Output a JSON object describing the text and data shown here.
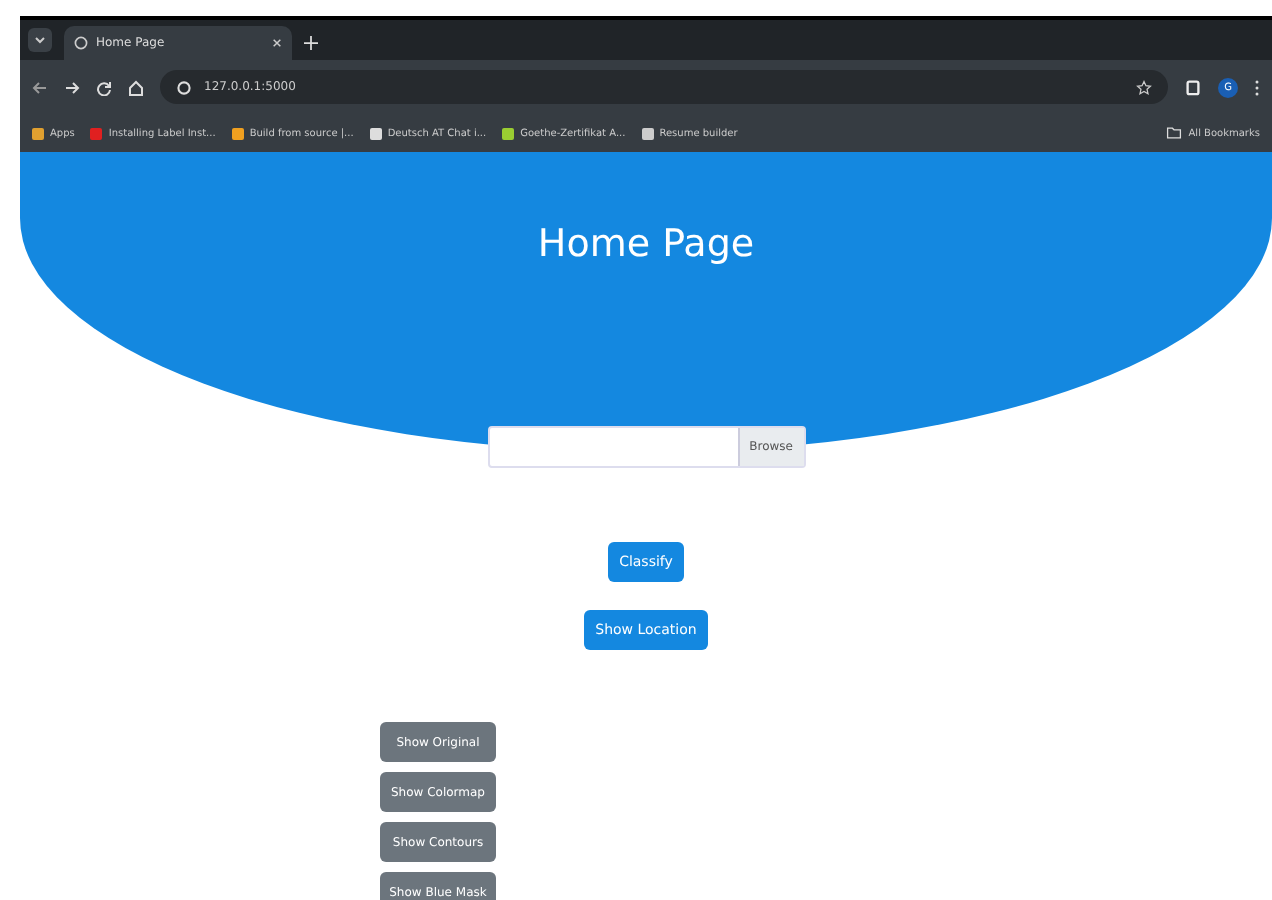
{
  "browser": {
    "tab_title": "Home Page",
    "url": "127.0.0.1:5000",
    "bookmarks": [
      {
        "label": "Apps",
        "color": "#e0a030"
      },
      {
        "label": "Installing Label Inst...",
        "color": "#e02020"
      },
      {
        "label": "Build from source |...",
        "color": "#f0a020"
      },
      {
        "label": "Deutsch AT Chat i...",
        "color": "#dddddd"
      },
      {
        "label": "Goethe-Zertifikat A...",
        "color": "#9acd32"
      },
      {
        "label": "Resume builder",
        "color": "#cccccc"
      }
    ],
    "all_bookmarks": "All Bookmarks",
    "profile": "G"
  },
  "page": {
    "title": "Home Page",
    "file_input": {
      "button": "Browse"
    },
    "primary_buttons": [
      "Classify",
      "Show Location"
    ],
    "secondary_buttons": [
      "Show Original",
      "Show Colormap",
      "Show Contours",
      "Show Blue Mask"
    ]
  }
}
